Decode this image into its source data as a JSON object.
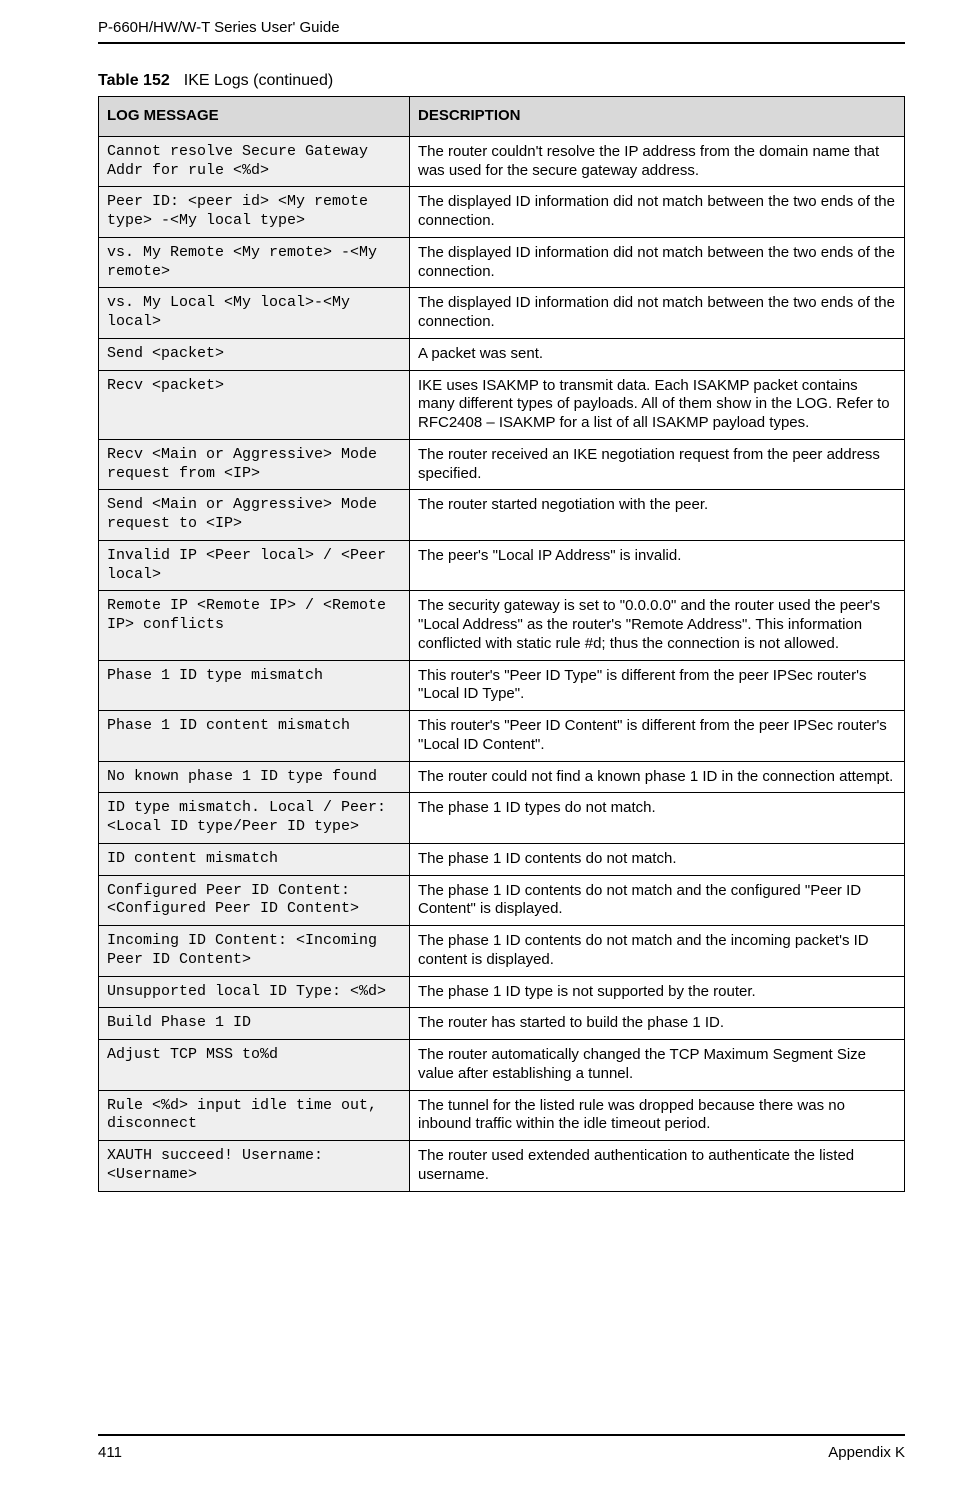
{
  "doc": {
    "header": "P-660H/HW/W-T Series User' Guide",
    "table_caption_title": "Table 152",
    "table_caption_rest": "IKE Logs (continued)",
    "columns": {
      "msg": "LOG MESSAGE",
      "desc": "DESCRIPTION"
    },
    "rows": [
      {
        "msg": "Cannot resolve Secure Gateway Addr for rule <%d>",
        "desc": "The router couldn't resolve the IP address from the domain name that was used for the secure gateway address."
      },
      {
        "msg": "Peer ID: <peer id> <My remote type> -<My local type>",
        "desc": "The displayed ID information did not match between the two ends of the connection."
      },
      {
        "msg": "vs. My Remote <My remote> -<My remote>",
        "desc": "The displayed ID information did not match between the two ends of the connection."
      },
      {
        "msg": "vs. My Local <My local>-<My local>",
        "desc": "The displayed ID information did not match between the two ends of the connection."
      },
      {
        "msg": "Send <packet>",
        "desc": "A packet was sent."
      },
      {
        "msg": "Recv <packet>",
        "desc": "IKE uses ISAKMP to transmit data. Each ISAKMP packet contains many different types of payloads. All of them show in the LOG. Refer to RFC2408 – ISAKMP for a list of all ISAKMP payload types."
      },
      {
        "msg": "Recv <Main or Aggressive> Mode request from <IP>",
        "desc": "The router received an IKE negotiation request from the peer address specified."
      },
      {
        "msg": "Send <Main or Aggressive> Mode request to <IP>",
        "desc": "The router started negotiation with the peer."
      },
      {
        "msg": "Invalid IP <Peer local> / <Peer local>",
        "desc": "The peer's \"Local IP Address\" is invalid."
      },
      {
        "msg": "Remote IP <Remote IP> / <Remote IP> conflicts",
        "desc": "The security gateway is set to \"0.0.0.0\" and the router used the peer's \"Local Address\" as the router's \"Remote Address\". This information conflicted with static rule #d; thus the connection is not allowed."
      },
      {
        "msg": "Phase 1 ID type mismatch",
        "desc": "This router's \"Peer ID Type\" is different from the peer IPSec router's \"Local ID Type\"."
      },
      {
        "msg": "Phase 1 ID content mismatch",
        "desc": "This router's \"Peer ID Content\" is different from the peer IPSec router's \"Local ID Content\"."
      },
      {
        "msg": "No known phase 1 ID type found",
        "desc": "The router could not find a known phase 1 ID in the connection attempt."
      },
      {
        "msg": "ID type mismatch. Local / Peer: <Local ID type/Peer ID type>",
        "desc": "The phase 1 ID types do not match."
      },
      {
        "msg": "ID content mismatch",
        "desc": "The phase 1 ID contents do not match."
      },
      {
        "msg": "Configured Peer ID Content: <Configured Peer ID Content>",
        "desc": "The phase 1 ID contents do not match and the configured \"Peer ID Content\" is displayed."
      },
      {
        "msg": "Incoming ID Content: <Incoming Peer ID Content>",
        "desc": "The phase 1 ID contents do not match and the incoming packet's ID content is displayed."
      },
      {
        "msg": "Unsupported local ID Type: <%d>",
        "desc": "The phase 1 ID type is not supported by the router."
      },
      {
        "msg": "Build Phase 1 ID",
        "desc": "The router has started to build the phase 1 ID."
      },
      {
        "msg": "Adjust TCP MSS to%d",
        "desc": "The router automatically changed the TCP Maximum Segment Size value after establishing a tunnel."
      },
      {
        "msg": "Rule <%d> input idle time out, disconnect",
        "desc": "The tunnel for the listed rule was dropped because there was no inbound traffic within the idle timeout period."
      },
      {
        "msg": "XAUTH succeed! Username: <Username>",
        "desc": "The router used extended authentication to authenticate the listed username."
      }
    ],
    "footer_left": "411",
    "footer_right": "Appendix K"
  }
}
